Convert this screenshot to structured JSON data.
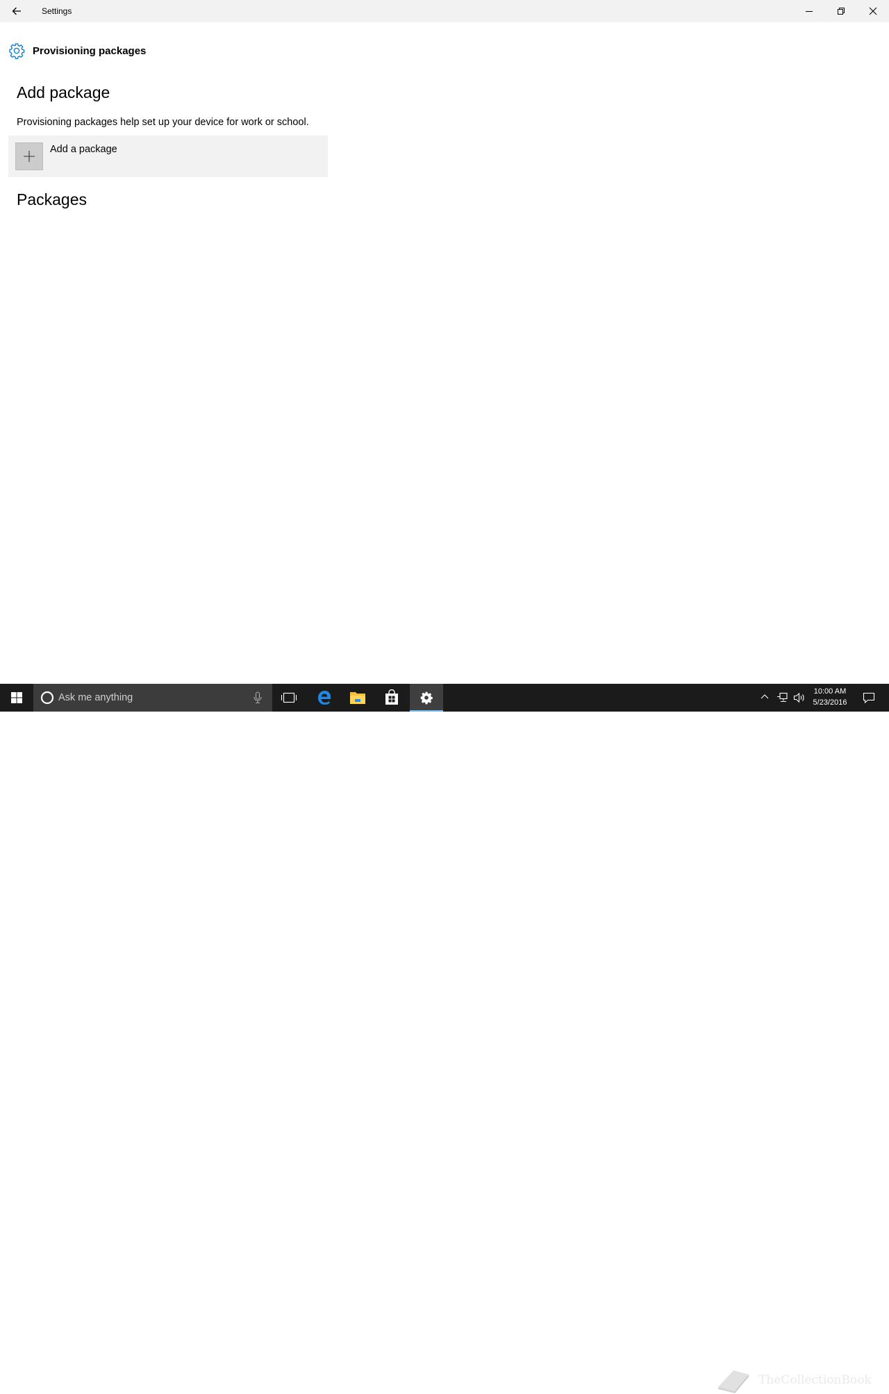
{
  "window": {
    "title": "Settings"
  },
  "page": {
    "header": "Provisioning packages",
    "add_section_title": "Add package",
    "description": "Provisioning packages help set up your device for work or school.",
    "add_button_label": "Add a package",
    "packages_section_title": "Packages"
  },
  "taskbar": {
    "search_placeholder": "Ask me anything",
    "clock_time": "10:00 AM",
    "clock_date": "5/23/2016",
    "apps": [
      "task-view",
      "edge",
      "file-explorer",
      "store",
      "settings"
    ],
    "active_app": "settings"
  },
  "watermark": {
    "text": "TheCollectionBook"
  },
  "colors": {
    "accent": "#0078d7",
    "titlebar_bg": "#f2f2f2",
    "taskbar_bg": "#1b1b1b",
    "search_bg": "#3c3c3c",
    "active_indicator": "#76b9ed"
  }
}
